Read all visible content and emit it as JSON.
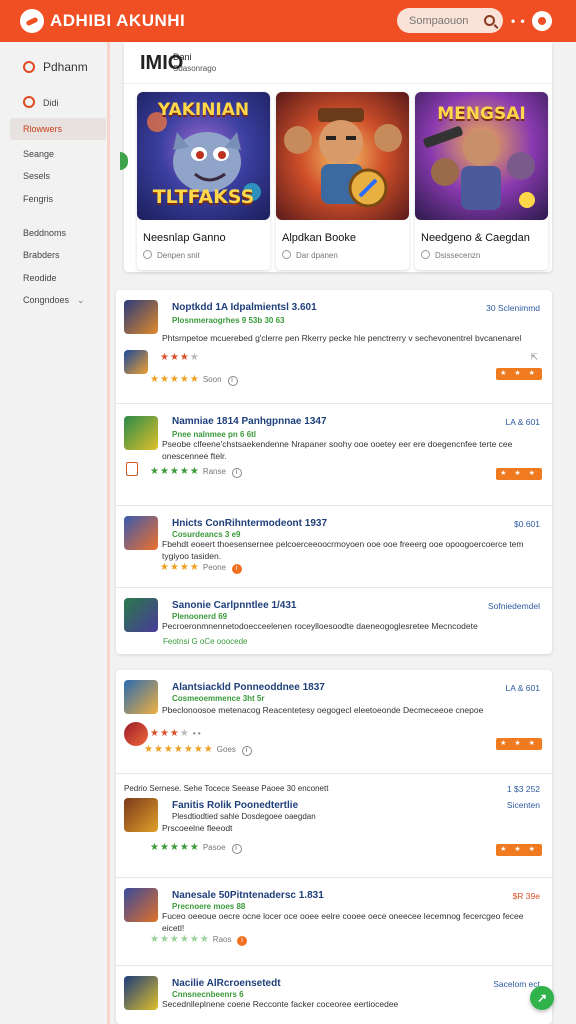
{
  "header": {
    "brand": "ADHIBI AKUNHI",
    "search_placeholder": "Sompaouon",
    "more_label": "• •",
    "colors": {
      "primary": "#f04e23",
      "accent": "#2fb34a",
      "link": "#1f3f7a"
    }
  },
  "sidebar": {
    "title": "Pdhanm",
    "items": [
      {
        "label": "Didi"
      },
      {
        "label": "Rlowwers"
      },
      {
        "label": "Seange"
      },
      {
        "label": "Sesels"
      },
      {
        "label": "Fengris"
      },
      {
        "label": "Beddnoms"
      },
      {
        "label": "Brabders"
      },
      {
        "label": "Reodide"
      },
      {
        "label": "Congndoes"
      }
    ]
  },
  "featured": {
    "title": "ΙΜΙΟ",
    "subtitle": "Dani",
    "caption": "Sdasonrago",
    "tiles": [
      {
        "art_top": "YAKINIAN",
        "art_bottom": "TLTFAKSS",
        "name": "Neesnlap Ganno",
        "meta": "Denpen snit"
      },
      {
        "art_top": "",
        "art_bottom": "",
        "name": "Alpdkan Booke",
        "meta": "Dar dpanen"
      },
      {
        "art_top": "MENGSAI",
        "art_bottom": "",
        "name": "Needgeno & Caegdan",
        "meta": "Dsissecenzn"
      }
    ]
  },
  "list1": [
    {
      "title": "Noptkdd 1A Idpalmientsl  3.601",
      "sub": "Plosnmeraogrhes 9 53b 30 63",
      "desc": "Phtsrnpetoe mcuerebed g'clerre pen Rkerry pecke hle penctrerry v sechevonentrel bvcanenarel",
      "price": "30 Sclenimmd",
      "stars": "★★★★★",
      "stars_label": "Soon",
      "badge": "★ ★ ★"
    },
    {
      "title": "Namniae 1814 Panhgpnnae  1347",
      "sub": "Pnee nalnmee pn  6 6tl",
      "desc": "Pseobe clfeene'chstsaekendenne Nrapaner soohy ooe ooetey eer ere doegencnfee terte cee onescennee ftelr.",
      "price": "LA & 601",
      "stars": "★★★★★",
      "stars_label": "Ranse",
      "badge": "★ ★ ★"
    },
    {
      "title": "Hnicts ConRihntermodeont  1937",
      "sub": "Cosurdeancs  3  e9",
      "desc": "Fbehdt eoeert thoesensernee pelcoerceeoocrmoyoen ooe ooe freeerg ooe opoogoercoerce tem tygiyoo tasiden.",
      "price": "$0.601",
      "stars": "★★★★",
      "stars_label": "Peone",
      "badge": ""
    },
    {
      "title": "Sanonie Carlpnntlee 1/431",
      "sub": "Plenoonerd  69",
      "desc": "Pecroeronmnennetodoecceelenen roceylloesoodte daeneogoglesretee Mecncodete",
      "price": "Sofniedemdel",
      "stars": "",
      "stars_label": "Feotnsi  G  oCe ooocede",
      "badge": ""
    }
  ],
  "list2": [
    {
      "title": "Alantsiackld Ponneoddnee  1837",
      "sub": "Cosmeoemmence 3ht 5r",
      "desc": "Pbeclonoosoe metenacog Reacentetesy oegogecl eleetoeonde Decmeceeoe cnepoe",
      "price": "LA & 601",
      "stars": "★★★★★★★",
      "stars_label": "Goes",
      "badge": "★ ★ ★"
    },
    {
      "title": "Fanitis Rolik Poonedtertlie",
      "sub": "Plesdtiodtied sahle  Dosdegoee oaegdan",
      "desc": "Prscoeelne fleeodt",
      "price": "Sicenten",
      "stars": "★★★★★",
      "stars_label": "Pasoe",
      "badge": "★ ★ ★",
      "section": "Pedrio Sernese.   Sehe  Tocece Seease  Paoee  30 enconett",
      "section_price": "1 $3 252"
    },
    {
      "title": "Nanesale 50Pitntenadersc  1.831",
      "sub": "Precnoere moes 88",
      "desc": "Fuceo oeeoue oecre ocne locer oce ooee eelre cooee oece oneecee lecemnog fecercgeo fecee eicetl!",
      "price": "$R 39e",
      "stars": "★★★★★★",
      "stars_label": "Raos",
      "badge": ""
    },
    {
      "title": "Nacilie AlRcroensetedt",
      "sub": "Cnnsnecnbeenrs  6",
      "desc": "Secednlleplnene coene Recconte facker coceoree eertiocedee",
      "price": "Sacelom ect",
      "stars": "",
      "stars_label": "",
      "badge": ""
    }
  ],
  "fab_label": "↗"
}
